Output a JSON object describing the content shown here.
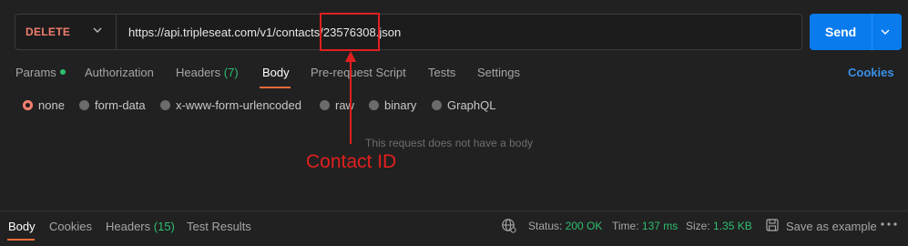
{
  "request": {
    "method": "DELETE",
    "url": "https://api.tripleseat.com/v1/contacts/23576308.json",
    "send_label": "Send"
  },
  "tabs": {
    "params": "Params",
    "authorization": "Authorization",
    "headers": "Headers",
    "headers_count": "(7)",
    "body": "Body",
    "prerequest": "Pre-request Script",
    "tests": "Tests",
    "settings": "Settings",
    "cookies": "Cookies"
  },
  "body_types": {
    "none": "none",
    "form_data": "form-data",
    "urlencoded": "x-www-form-urlencoded",
    "raw": "raw",
    "binary": "binary",
    "graphql": "GraphQL",
    "selected": "none"
  },
  "empty_message": "This request does not have a body",
  "annotation": {
    "label": "Contact ID",
    "color": "#e0201e"
  },
  "response": {
    "tabs": {
      "body": "Body",
      "cookies": "Cookies",
      "headers": "Headers",
      "headers_count": "(15)",
      "test_results": "Test Results"
    },
    "status_label": "Status:",
    "status_value": "200 OK",
    "time_label": "Time:",
    "time_value": "137 ms",
    "size_label": "Size:",
    "size_value": "1.35 KB",
    "save_label": "Save as example",
    "more": "ooo"
  },
  "colors": {
    "accent": "#097bed",
    "method": "#f07e6e",
    "success": "#2fbf71",
    "active_tab": "#f26b3a"
  }
}
